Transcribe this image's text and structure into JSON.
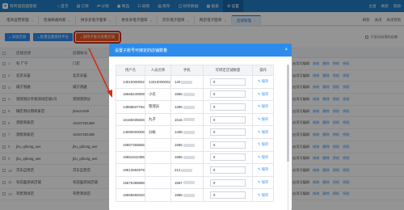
{
  "header": {
    "brand": "有所值前面管家",
    "menu": [
      {
        "icon": "⌂",
        "label": "首页",
        "active": false
      },
      {
        "icon": "▤",
        "label": "订单",
        "active": false
      },
      {
        "icon": "⇄",
        "label": "分销",
        "active": false
      },
      {
        "icon": "▣",
        "label": "商品",
        "active": false
      },
      {
        "icon": "☷",
        "label": "采购",
        "active": false
      },
      {
        "icon": "▥",
        "label": "库存",
        "active": false
      },
      {
        "icon": "◫",
        "label": "财务数据",
        "active": false
      },
      {
        "icon": "▦",
        "label": "报表",
        "active": false
      },
      {
        "icon": "⚙",
        "label": "设置",
        "active": true
      }
    ],
    "right": [
      "主窗",
      "刷新",
      "帮助"
    ]
  },
  "tabs": [
    {
      "label": "电商运营管理",
      "active": false
    },
    {
      "label": "普通微通商家",
      "active": false
    },
    {
      "label": "拼多多电子面单",
      "active": false
    },
    {
      "label": "拼多多电子面单",
      "active": false
    },
    {
      "label": "京东电子面单",
      "active": false
    },
    {
      "label": "网店电子面单",
      "active": false
    },
    {
      "label": "店铺管理",
      "active": true
    }
  ],
  "tab_tools": [
    "刷新",
    "关闭",
    "关闭其他"
  ],
  "toolbar": {
    "buttons": [
      "添加店铺",
      "批量设置授权平台",
      "调用子账号查看店铺"
    ],
    "note": "只显示启用的店铺"
  },
  "bg_table": {
    "columns": [
      "店铺名称",
      "店铺账号"
    ],
    "rows": [
      {
        "num": "1",
        "name": "有 广宁",
        "acct": "门店"
      },
      {
        "num": "2",
        "name": "北京天猫",
        "acct": "北京天猫"
      },
      {
        "num": "3",
        "name": "威宁测通",
        "acct": "威宁测通"
      },
      {
        "num": "4",
        "name": "测测测分享家测试店铺1号",
        "acct": "测测测测分"
      },
      {
        "num": "5",
        "name": "微店测分销商家店",
        "acct": "jhao21186"
      },
      {
        "num": "6",
        "name": "测客商家店",
        "acct": "16157281468"
      },
      {
        "num": "7",
        "name": "测客商家店",
        "acct": "16157281468"
      },
      {
        "num": "8",
        "name": "jhu_qihong_wei",
        "acct": "jhu_qihong_wei"
      },
      {
        "num": "9",
        "name": "jhu_qihong_wei",
        "acct": "jhu_qihong_wei"
      },
      {
        "num": "10",
        "name": "京东自营店",
        "acct": "京东自营店"
      },
      {
        "num": "11",
        "name": "有前面测试店铺",
        "acct": "有前面测试店铺"
      },
      {
        "num": "12",
        "name": "有赞测试店",
        "acct": "有赞测试店"
      }
    ],
    "status": "启用可编辑",
    "actions": [
      "修改",
      "删除",
      "授权",
      "授权"
    ]
  },
  "modal": {
    "title": "设置子账号可绑定的店铺数量",
    "columns": [
      "用户名",
      "人员名称",
      "手机",
      "可绑定店铺数量",
      "操作"
    ],
    "save_label": "保存",
    "rows": [
      {
        "uid": "14010000002",
        "name": "14010000002",
        "phone": "140",
        "qty": "0"
      },
      {
        "uid": "18668240809",
        "name": "小名",
        "phone": "1866",
        "qty": "0"
      },
      {
        "uid": "13968637784",
        "name": "管理员",
        "phone": "1396",
        "qty": "0"
      },
      {
        "uid": "15168335825",
        "name": "丸子",
        "phone": "1516",
        "qty": "0"
      },
      {
        "uid": "14080000009",
        "name": "分帐",
        "phone": "1408",
        "qty": "0"
      },
      {
        "uid": "15857459566",
        "name": "",
        "phone": "1585",
        "qty": "0"
      },
      {
        "uid": "18651642385",
        "name": "",
        "phone": "1865",
        "qty": "0"
      },
      {
        "uid": "18613682879",
        "name": "",
        "phone": "212",
        "qty": "0"
      },
      {
        "uid": "15875399888",
        "name": "",
        "phone": "1587",
        "qty": "0"
      },
      {
        "uid": "18655669333",
        "name": "",
        "phone": "1865",
        "qty": "0"
      }
    ]
  },
  "colors": {
    "nav": "#1f7cc3",
    "modal_header": "#2d8ceb",
    "annotation": "#d0311b",
    "highlight_button": "#e9541c"
  }
}
